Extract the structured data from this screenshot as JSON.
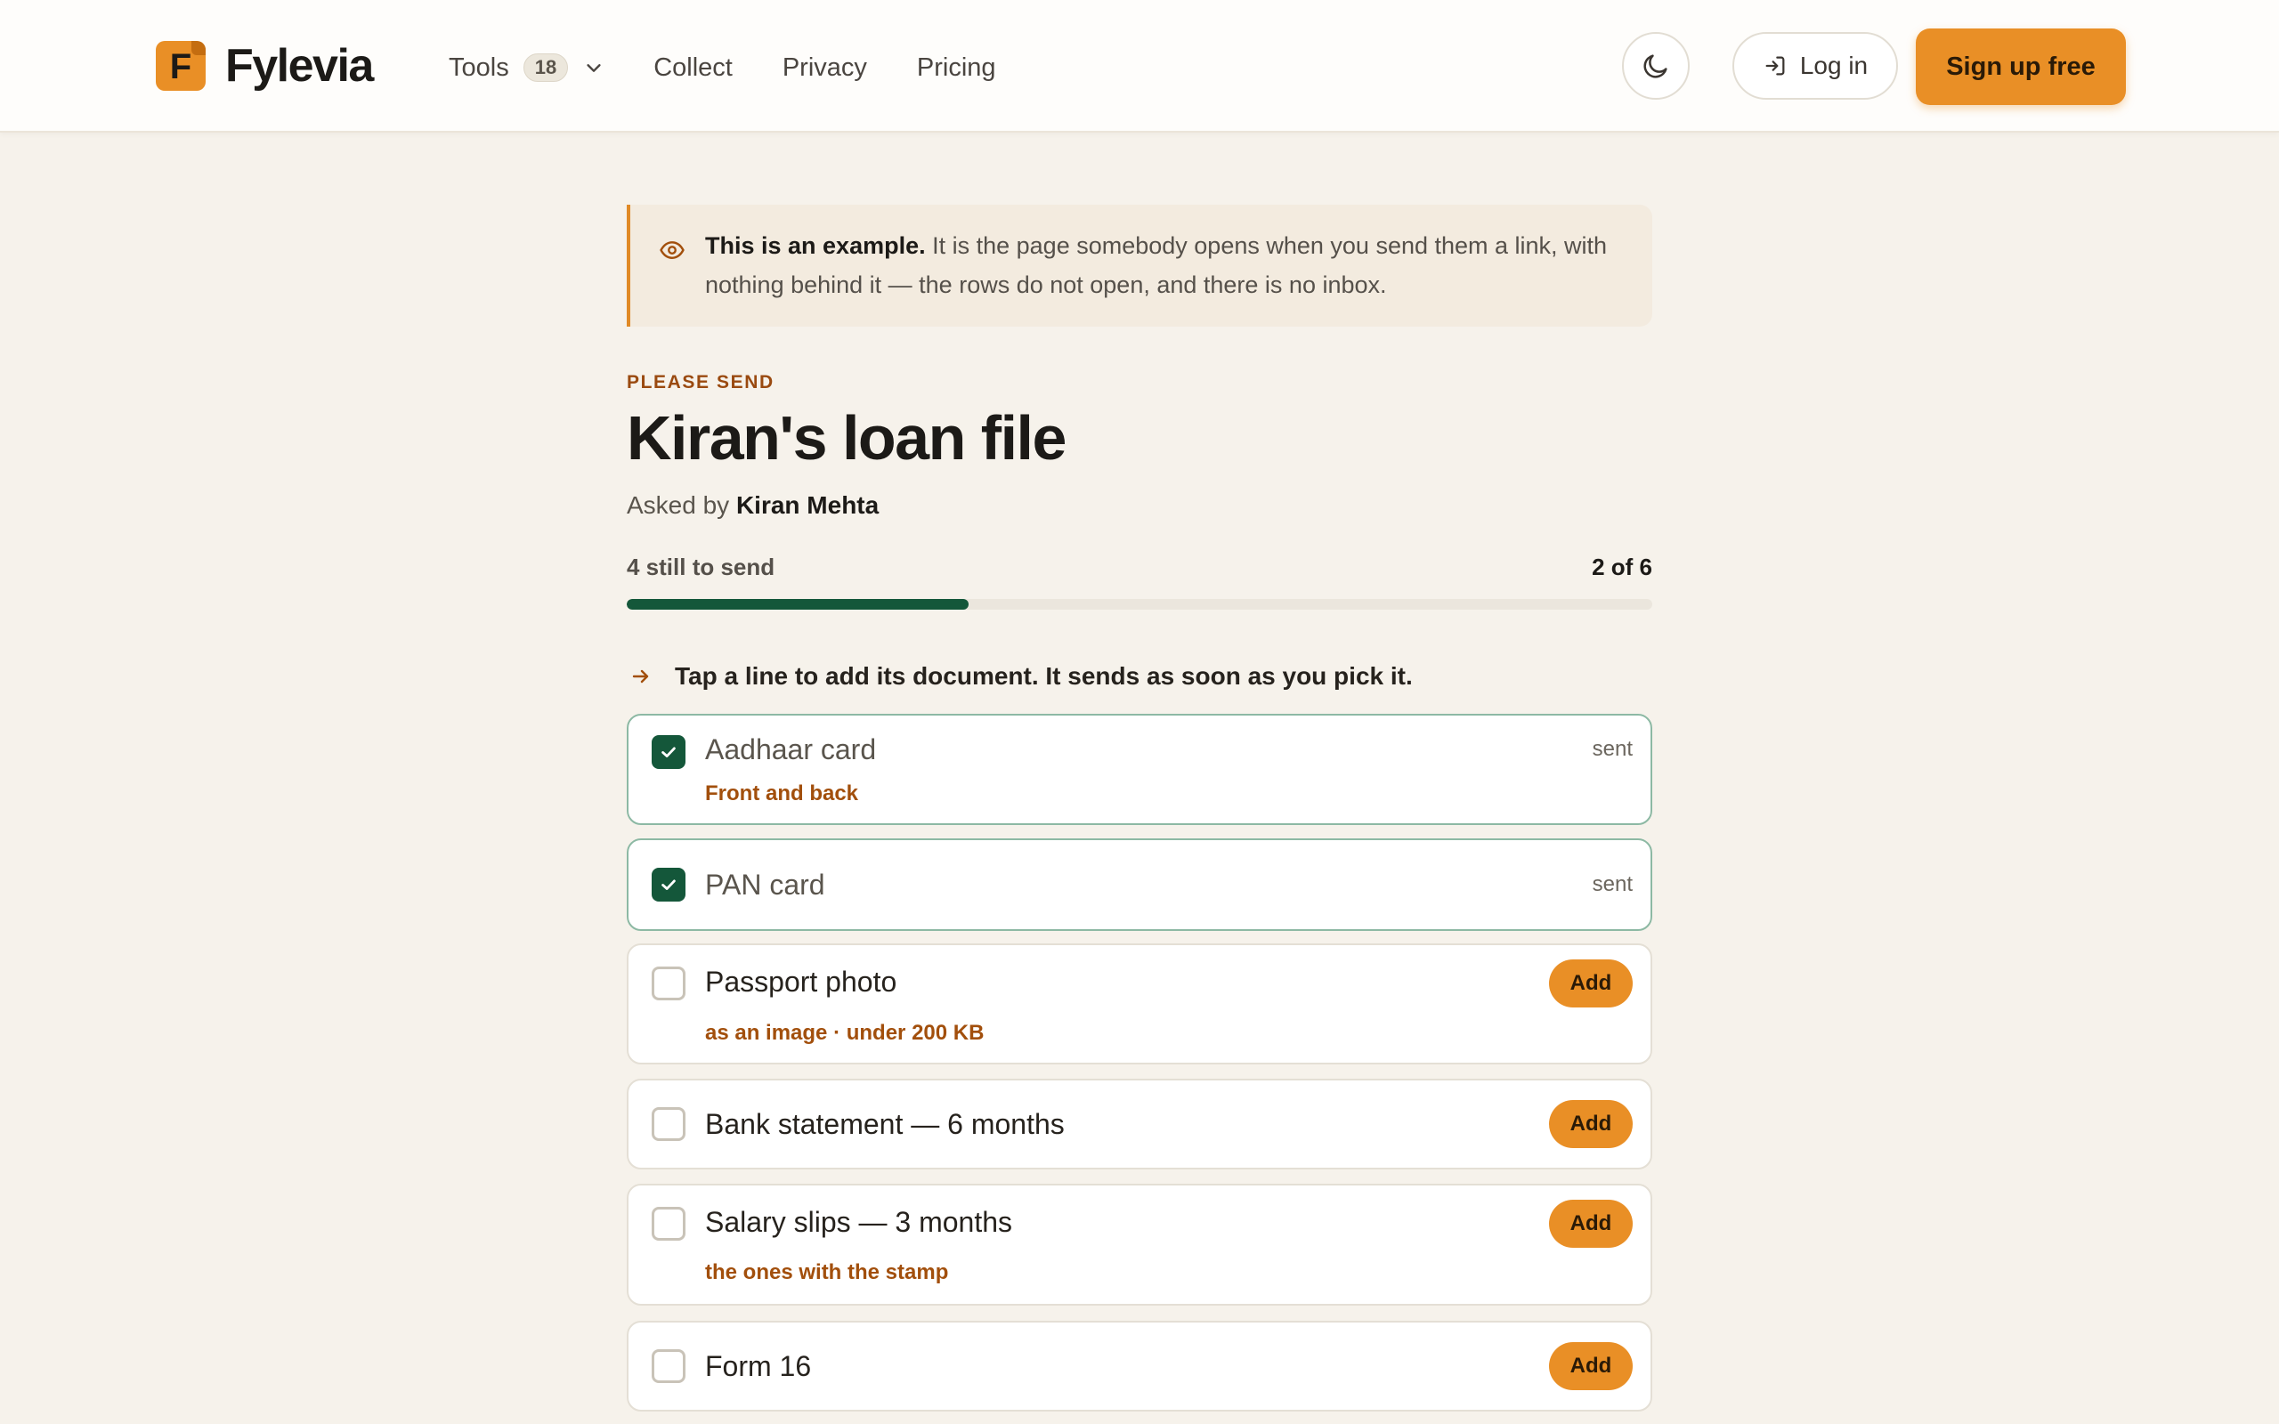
{
  "header": {
    "logo_letter": "F",
    "brand": "Fylevia",
    "nav": {
      "tools_label": "Tools",
      "tools_count": "18",
      "collect": "Collect",
      "privacy": "Privacy",
      "pricing": "Pricing"
    },
    "login_label": "Log in",
    "signup_label": "Sign up free"
  },
  "notice": {
    "lead": "This is an example.",
    "text": " It is the page somebody opens when you send them a link, with nothing behind it — the rows do not open, and there is no inbox."
  },
  "request": {
    "eyebrow": "PLEASE SEND",
    "title": "Kiran's loan file",
    "asked_prefix": "Asked by ",
    "asked_by": "Kiran Mehta",
    "remaining": "4 still to send",
    "count": "2 of 6",
    "progress_fraction": 0.333,
    "hint": "Tap a line to add its document. It sends as soon as you pick it."
  },
  "documents": [
    {
      "label": "Aadhaar card",
      "note": "Front and back",
      "status": "sent"
    },
    {
      "label": "PAN card",
      "note": "",
      "status": "sent"
    },
    {
      "label": "Passport photo",
      "note": "as an image · under 200 KB",
      "action": "Add"
    },
    {
      "label": "Bank statement — 6 months",
      "note": "",
      "action": "Add"
    },
    {
      "label": "Salary slips — 3 months",
      "note": "the ones with the stamp",
      "action": "Add"
    },
    {
      "label": "Form 16",
      "note": "",
      "action": "Add"
    }
  ],
  "colors": {
    "accent": "#e98f26",
    "success": "#14573a",
    "note": "#a24f0c",
    "background": "#f6f2eb"
  },
  "icons": {
    "theme": "moon-icon",
    "login": "login-icon",
    "notice": "eye-icon",
    "hint": "arrow-right-icon",
    "tools_caret": "chevron-down-icon",
    "done": "check-icon"
  }
}
